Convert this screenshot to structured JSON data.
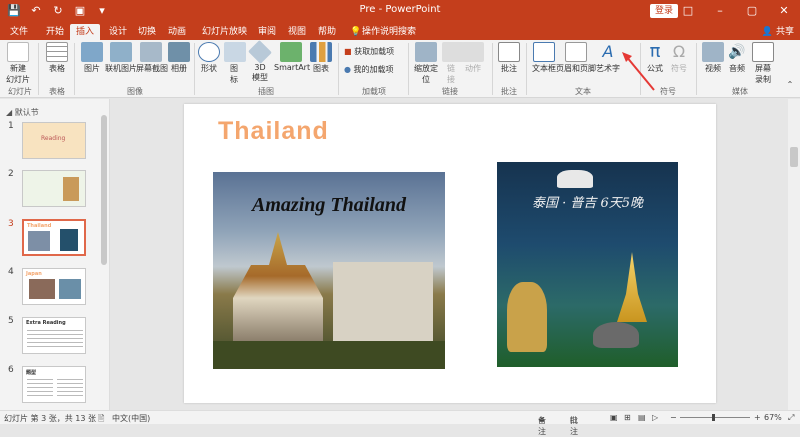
{
  "window": {
    "title": "Pre  -  PowerPoint",
    "login_label": "登录",
    "share_label": "共享",
    "search_hint": "操作说明搜索"
  },
  "tabs": [
    "文件",
    "开始",
    "插入",
    "设计",
    "切换",
    "动画",
    "幻灯片放映",
    "审阅",
    "视图",
    "帮助"
  ],
  "active_tab_index": 2,
  "ribbon": {
    "groups": [
      "幻灯片",
      "表格",
      "图像",
      "插图",
      "加载项",
      "链接",
      "批注",
      "文本",
      "符号",
      "媒体"
    ],
    "buttons": {
      "new_slide": "新建\n幻灯片",
      "table": "表格",
      "picture": "图片",
      "online_picture": "联机图片",
      "screenshot": "屏幕截图",
      "album": "相册",
      "shapes": "形状",
      "icons": "图\n标",
      "model_3d": "3D\n模型",
      "smartart": "SmartArt",
      "chart": "图表",
      "get_addins": "获取加载项",
      "my_addins": "我的加载项",
      "zoom": "缩放定\n位",
      "link": "链\n接",
      "action": "动作",
      "comment": "批注",
      "textbox": "文本框",
      "header_footer": "页眉和页脚",
      "wordart": "艺术字",
      "equation": "公式",
      "symbol": "符号",
      "video": "视频",
      "audio": "音频",
      "screen_recording": "屏幕\n录制"
    }
  },
  "thumbnails": {
    "section": "默认节",
    "items": [
      {
        "num": "1",
        "label": "Reading"
      },
      {
        "num": "2",
        "label": ""
      },
      {
        "num": "3",
        "label": "Thailand"
      },
      {
        "num": "4",
        "label": "Japan"
      },
      {
        "num": "5",
        "label": "Extra Reading"
      },
      {
        "num": "6",
        "label": "题型"
      }
    ],
    "active_index": 2
  },
  "slide": {
    "title": "Thailand",
    "left_image_caption": "Amazing Thailand",
    "right_image_caption": "泰国 · 普吉 6天5晚"
  },
  "status": {
    "slide_info": "幻灯片 第 3 张，共 13 张",
    "language": "中文(中国)",
    "notes": "备注",
    "comments": "批注",
    "zoom": "67%"
  },
  "colors": {
    "accent": "#c43e1c",
    "title": "#f4a66e"
  }
}
